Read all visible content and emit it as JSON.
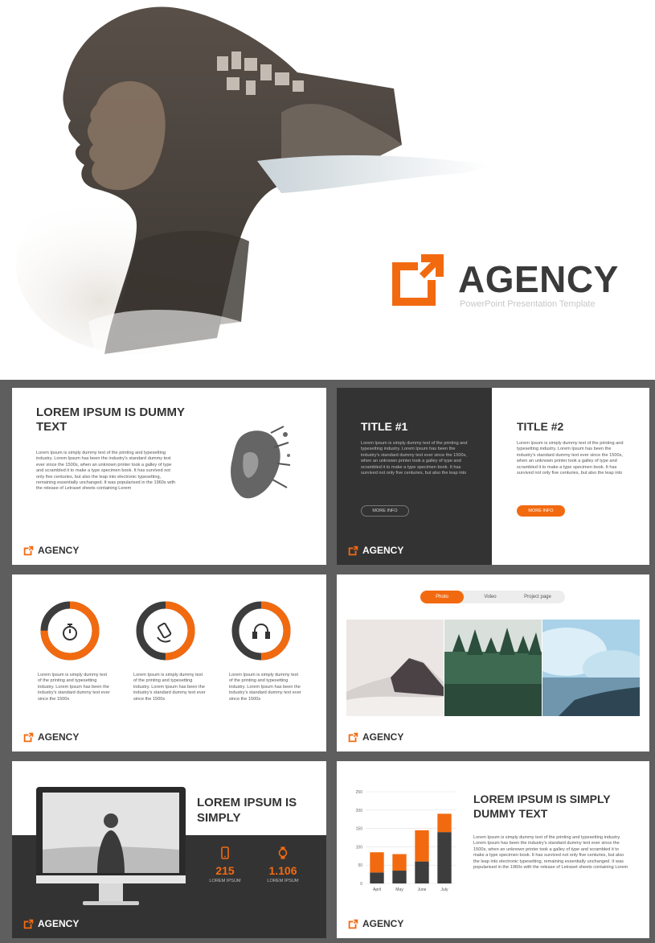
{
  "colors": {
    "accent": "#f26a10",
    "dark": "#333333",
    "grid_bg": "#5e5e5e"
  },
  "hero": {
    "brand_name": "AGENCY",
    "brand_subtitle": "PowerPoint Presentation Template"
  },
  "footer_brand": "AGENCY",
  "lorem_long": "Lorem Ipsum is simply dummy text of the printing and typesetting industry. Lorem Ipsum has been the industry's standard dummy text ever since the 1500s, when an unknown printer took a galley of type and scrambled it to make a type specimen book. It has survived not only five centuries, but also the leap into electronic typesetting, remaining essentially unchanged. It was popularised in the 1960s with the release of Letraset sheets containing Lorem",
  "slide1": {
    "title": "LOREM IPSUM IS DUMMY TEXT",
    "body": "Lorem Ipsum is simply dummy text of the printing and typesetting industry. Lorem Ipsum has been the industry's standard dummy text ever since the 1500s, when an unknown printer took a galley of type and scrambled it to make a type specimen book. It has survived not only five centuries, but also the leap into electronic typesetting, remaining essentially unchanged. It was popularised in the 1960s with the release of Letraset sheets containing Lorem"
  },
  "slide2": {
    "title1": "TITLE #1",
    "body1": "Lorem Ipsum is simply dummy text of the printing and typesetting industry. Lorem Ipsum has been the industry's standard dummy text ever since the 1500s, when an unknown printer took a galley of type and scrambled it to make a type specimen book. It has survived not only five centuries, but also the leap into",
    "button1": "MORE INFO",
    "title2": "TITLE #2",
    "body2": "Lorem Ipsum is simply dummy text of the printing and typesetting industry. Lorem Ipsum has been the industry's standard dummy text ever since the 1500s, when an unknown printer took a galley of type and scrambled it to make a type specimen book. It has survived not only five centuries, but also the leap into",
    "button2": "MORE INFO"
  },
  "slide3": {
    "items": [
      {
        "icon": "stopwatch-icon",
        "progress": 0.75,
        "text": "Lorem Ipsum is simply dummy text of the printing and typesetting industry. Lorem Ipsum has been the industry's standard dummy text ever since the 1500s"
      },
      {
        "icon": "phone-rotate-icon",
        "progress": 0.5,
        "text": "Lorem Ipsum is simply dummy text of the printing and typesetting industry. Lorem Ipsum has been the industry's standard dummy text ever since the 1500s"
      },
      {
        "icon": "headphones-icon",
        "progress": 0.5,
        "text": "Lorem Ipsum is simply dummy text of the printing and typesetting industry. Lorem Ipsum has been the industry's standard dummy text ever since the 1500s"
      }
    ]
  },
  "slide4": {
    "tabs": [
      "Photo",
      "Video",
      "Project page"
    ],
    "active_tab": "Photo"
  },
  "slide5": {
    "title": "LOREM IPSUM IS SIMPLY",
    "stats": [
      {
        "icon": "smartphone-icon",
        "value": "215",
        "label": "LOREM IPSUM"
      },
      {
        "icon": "watch-icon",
        "value": "1.106",
        "label": "LOREM IPSUM"
      }
    ]
  },
  "slide6": {
    "title": "LOREM IPSUM IS SIMPLY DUMMY TEXT",
    "body": "Lorem Ipsum is simply dummy text of the printing and typesetting industry. Lorem Ipsum has been the industry's standard dummy text ever since the 1500s, when an unknown printer took a galley of type and scrambled it to make a type specimen book. It has survived not only five centuries, but also the leap into electronic typesetting, remaining essentially unchanged. It was popularised in the 1960s with the release of Letraset sheets containing Lorem"
  },
  "chart_data": {
    "type": "bar",
    "stacked": true,
    "categories": [
      "April",
      "May",
      "June",
      "July"
    ],
    "series": [
      {
        "values": [
          30,
          35,
          60,
          140
        ]
      },
      {
        "values": [
          55,
          45,
          85,
          50
        ]
      }
    ],
    "ylim": [
      0,
      250
    ],
    "yticks": [
      0,
      50,
      100,
      150,
      200,
      250
    ],
    "grid": true
  }
}
